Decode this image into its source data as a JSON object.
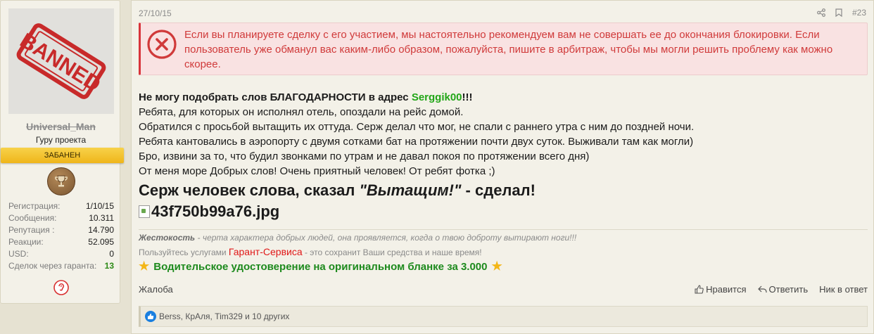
{
  "user": {
    "avatar_stamp_text": "BANNED",
    "username": "Universal_Man",
    "title": "Гуру проекта",
    "banner": "ЗАБАНЕН",
    "stats": [
      {
        "label": "Регистрация:",
        "value": "1/10/15"
      },
      {
        "label": "Сообщения:",
        "value": "10.311"
      },
      {
        "label": "Репутация :",
        "value": "14.790"
      },
      {
        "label": "Реакции:",
        "value": "52.095"
      },
      {
        "label": "USD:",
        "value": "0"
      },
      {
        "label": "Сделок через гаранта:",
        "value": "13"
      }
    ]
  },
  "post": {
    "date": "27/10/15",
    "number": "#23",
    "alert_text": "Если вы планируете сделку с его участием, мы настоятельно рекомендуем вам не совершать ее до окончания блокировки. Если пользователь уже обманул вас каким-либо образом, пожалуйста, пишите в арбитраж, чтобы мы могли решить проблему как можно скорее.",
    "line1_prefix": "Не могу подобрать слов БЛАГОДАРНОСТИ в адрес ",
    "line1_name": "Serggik00",
    "line1_suffix": "!!!",
    "lines": [
      "Ребята, для которых он исполнял отель, опоздали на рейс домой.",
      "Обратился с просьбой вытащить их оттуда. Серж делал что мог, не спали с раннего утра с ним до поздней ночи.",
      "Ребята кантовались в аэропорту с двумя сотками бат на протяжении почти двух суток. Выживали там как могли)",
      "Бро, извини за то, что будил звонками по утрам и не давал покоя по протяжении всего дня)",
      "От меня море Добрых слов! Очень приятный человек! От ребят фотка ;)"
    ],
    "big_prefix": "Серж человек слова, сказал ",
    "big_quote": "\"Вытащим!\"",
    "big_suffix": " - сделал!",
    "image_alt": "43f750b99a76.jpg"
  },
  "signature": {
    "line1_bold": "Жестокость",
    "line1_rest": " - черта характера добрых людей, она проявляется, когда о твою доброту вытирают ноги!!!",
    "line2_prefix": "Пользуйтесь услугами ",
    "line2_link": "Гарант-Сервиса",
    "line2_suffix": " - это сохранит Ваши средства и наше время!",
    "line3": "Водительское удостоверение на оригинальном бланке за 3.000"
  },
  "footer": {
    "report": "Жалоба",
    "like": "Нравится",
    "reply": "Ответить",
    "nick": "Ник в ответ"
  },
  "reactions": {
    "text": "Berss, КрАля, Tim329 и 10 других"
  },
  "colors": {
    "alert_red": "#d03a3a",
    "username_green": "#22a618",
    "banner_yellow": "#f3c43a",
    "signature_green": "#1d8a1d"
  }
}
